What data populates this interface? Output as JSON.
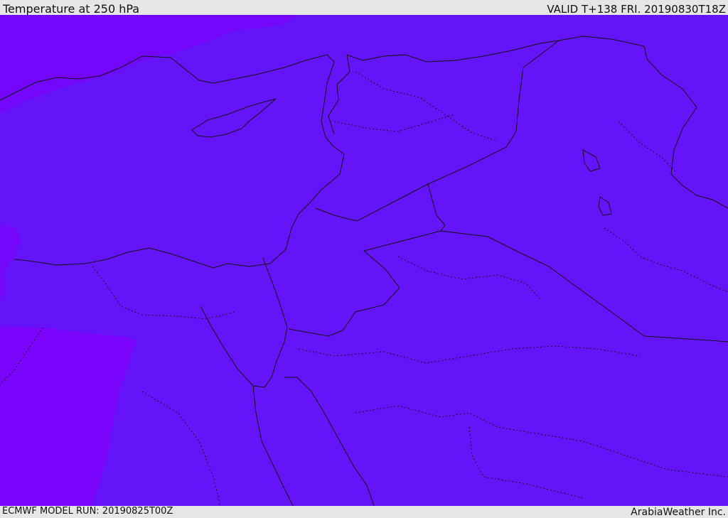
{
  "header": {
    "title": "Temperature at 250 hPa",
    "valid": "VALID T+138 FRI. 20190830T18Z"
  },
  "footer": {
    "model_run": "ECMWF MODEL RUN: 20190825T00Z",
    "credit": "ArabiaWeather Inc."
  },
  "colors": {
    "field_main": "#6514fa",
    "field_cold": "#7a07fb",
    "border": "#111111",
    "frame": "#e6e6e6"
  }
}
